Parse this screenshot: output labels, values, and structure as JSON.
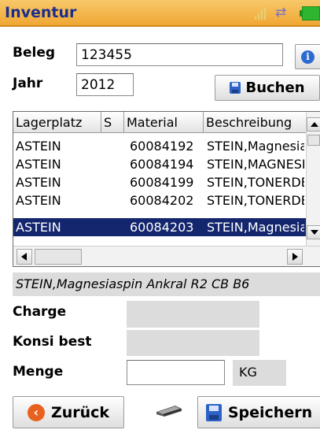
{
  "app": {
    "title": "Inventur"
  },
  "status_icons": [
    "signal-icon",
    "connection-icon",
    "battery-icon"
  ],
  "form": {
    "beleg_label": "Beleg",
    "beleg_value": "123455",
    "jahr_label": "Jahr",
    "jahr_value": "2012",
    "buchen_label": "Buchen"
  },
  "grid": {
    "columns": [
      "Lagerplatz",
      "S",
      "Material",
      "Beschreibung"
    ],
    "rows": [
      {
        "lagerplatz": "ASTEIN",
        "s": "",
        "material": "60084192",
        "beschreibung": "STEIN,Magnesiaspin"
      },
      {
        "lagerplatz": "ASTEIN",
        "s": "",
        "material": "60084194",
        "beschreibung": "STEIN,MAGNESIA"
      },
      {
        "lagerplatz": "ASTEIN",
        "s": "",
        "material": "60084199",
        "beschreibung": "STEIN,TONERDE"
      },
      {
        "lagerplatz": "ASTEIN",
        "s": "",
        "material": "60084202",
        "beschreibung": "STEIN,TONERDE"
      },
      {
        "lagerplatz": "ASTEIN",
        "s": "",
        "material": "60084203",
        "beschreibung": "STEIN,Magnesiaspin"
      }
    ],
    "selected_index": 4
  },
  "detail": {
    "description": "STEIN,Magnesiaspin Ankral R2 CB B6",
    "charge_label": "Charge",
    "charge_value": "",
    "konsi_label": "Konsi best",
    "konsi_value": "",
    "menge_label": "Menge",
    "menge_value": "",
    "unit": "KG"
  },
  "footer": {
    "back_label": "Zurück",
    "save_label": "Speichern"
  },
  "colors": {
    "titlebar": "#f0a733",
    "title_text": "#1a2e8c",
    "selection": "#13266e",
    "info_icon": "#2b6bd1",
    "save_icon": "#2d63c8",
    "back_icon": "#e8621f"
  }
}
